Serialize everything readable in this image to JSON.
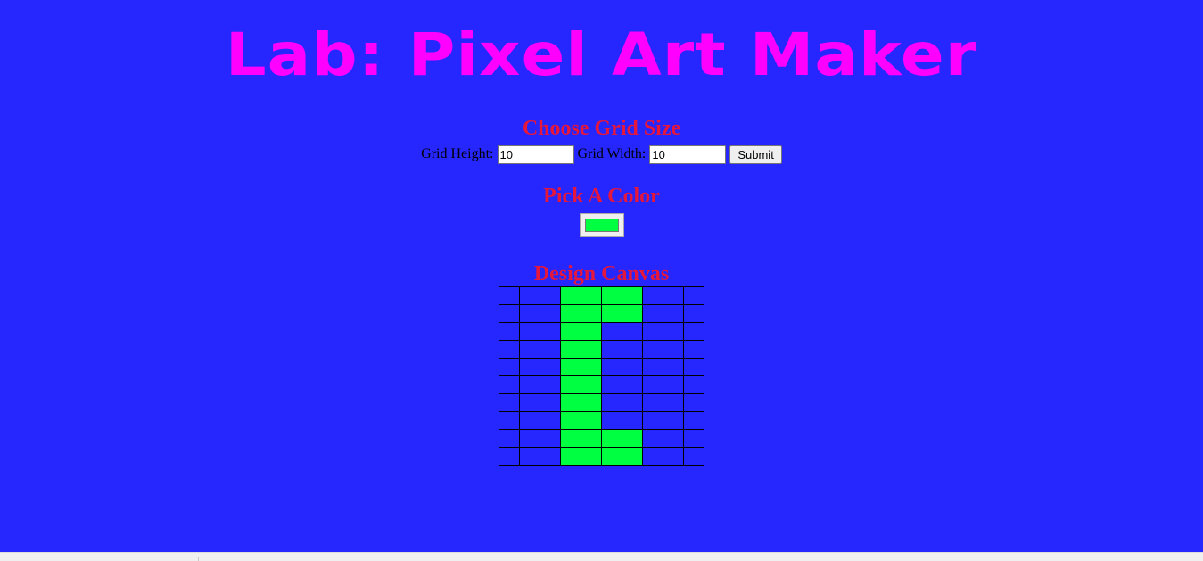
{
  "page": {
    "title": "Lab: Pixel Art Maker",
    "background": "#2626ff",
    "title_color": "#ff00ff",
    "heading_color": "#e5173c"
  },
  "grid_size": {
    "heading": "Choose Grid Size",
    "height_label": "Grid Height:",
    "height_value": "10",
    "width_label": "Grid Width:",
    "width_value": "10",
    "submit_label": "Submit"
  },
  "color": {
    "heading": "Pick A Color",
    "selected": "#00ff40"
  },
  "canvas": {
    "heading": "Design Canvas",
    "rows": 10,
    "cols": 10,
    "empty_color": "#2626ff",
    "fill_color": "#00ff40",
    "filled_cells": [
      [
        0,
        3
      ],
      [
        0,
        4
      ],
      [
        0,
        5
      ],
      [
        0,
        6
      ],
      [
        1,
        3
      ],
      [
        1,
        4
      ],
      [
        1,
        5
      ],
      [
        1,
        6
      ],
      [
        2,
        3
      ],
      [
        2,
        4
      ],
      [
        3,
        3
      ],
      [
        3,
        4
      ],
      [
        4,
        3
      ],
      [
        4,
        4
      ],
      [
        5,
        3
      ],
      [
        5,
        4
      ],
      [
        6,
        3
      ],
      [
        6,
        4
      ],
      [
        7,
        3
      ],
      [
        7,
        4
      ],
      [
        8,
        3
      ],
      [
        8,
        4
      ],
      [
        8,
        5
      ],
      [
        8,
        6
      ],
      [
        9,
        3
      ],
      [
        9,
        4
      ],
      [
        9,
        5
      ],
      [
        9,
        6
      ]
    ]
  }
}
